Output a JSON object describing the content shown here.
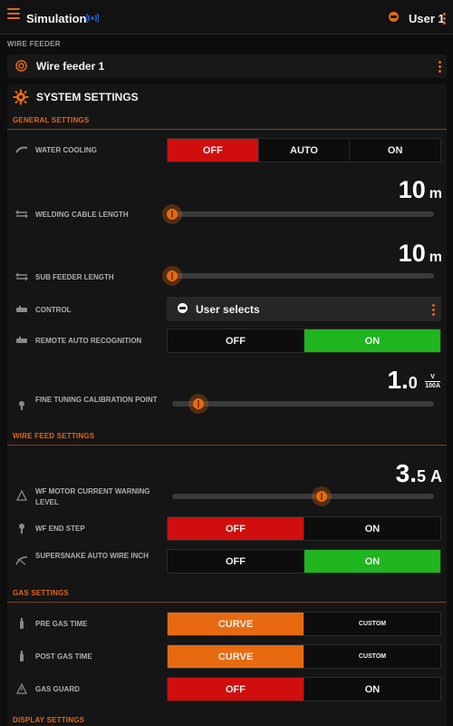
{
  "header": {
    "title": "Simulation",
    "user": "User 1"
  },
  "wire_feeder": {
    "section_label": "WIRE FEEDER",
    "name": "Wire feeder 1"
  },
  "system_settings": {
    "title": "SYSTEM SETTINGS",
    "general": {
      "label": "GENERAL SETTINGS",
      "water_cooling": {
        "label": "WATER COOLING",
        "options": [
          "OFF",
          "AUTO",
          "ON"
        ],
        "selected": "OFF"
      },
      "welding_cable_length": {
        "label": "WELDING CABLE LENGTH",
        "value": "10",
        "unit": "m",
        "level": 0
      },
      "sub_feeder_length": {
        "label": "SUB FEEDER LENGTH",
        "value": "10",
        "unit": "m",
        "level": 0
      },
      "control": {
        "label": "CONTROL",
        "value": "User selects"
      },
      "remote_auto_recognition": {
        "label": "REMOTE AUTO RECOGNITION",
        "options": [
          "OFF",
          "ON"
        ],
        "selected": "ON"
      },
      "fine_tuning": {
        "label": "FINE TUNING CALIBRATION POINT",
        "value_int": "1.",
        "value_dec": "0",
        "unit_top": "V",
        "unit_bottom": "100A",
        "level": 0.1
      }
    },
    "wire_feed": {
      "label": "WIRE FEED SETTINGS",
      "wf_motor_current": {
        "label": "WF MOTOR CURRENT WARNING LEVEL",
        "value_int": "3.",
        "value_dec": "5",
        "unit": "A",
        "level": 0.55
      },
      "wf_end_step": {
        "label": "WF END STEP",
        "options": [
          "OFF",
          "ON"
        ],
        "selected": "OFF"
      },
      "supersnake": {
        "label": "SUPERSNAKE AUTO WIRE INCH",
        "options": [
          "OFF",
          "ON"
        ],
        "selected": "ON"
      }
    },
    "gas": {
      "label": "GAS SETTINGS",
      "pre_gas_time": {
        "label": "PRE GAS TIME",
        "options": [
          "CURVE",
          "CUSTOM"
        ],
        "selected": "CURVE"
      },
      "post_gas_time": {
        "label": "POST GAS TIME",
        "options": [
          "CURVE",
          "CUSTOM"
        ],
        "selected": "CURVE"
      },
      "gas_guard": {
        "label": "GAS GUARD",
        "options": [
          "OFF",
          "ON"
        ],
        "selected": "OFF"
      }
    },
    "display": {
      "label": "DISPLAY SETTINGS"
    }
  },
  "colors": {
    "accent": "#e86a10",
    "off_red": "#d00e0e",
    "on_green": "#1fb51f"
  }
}
